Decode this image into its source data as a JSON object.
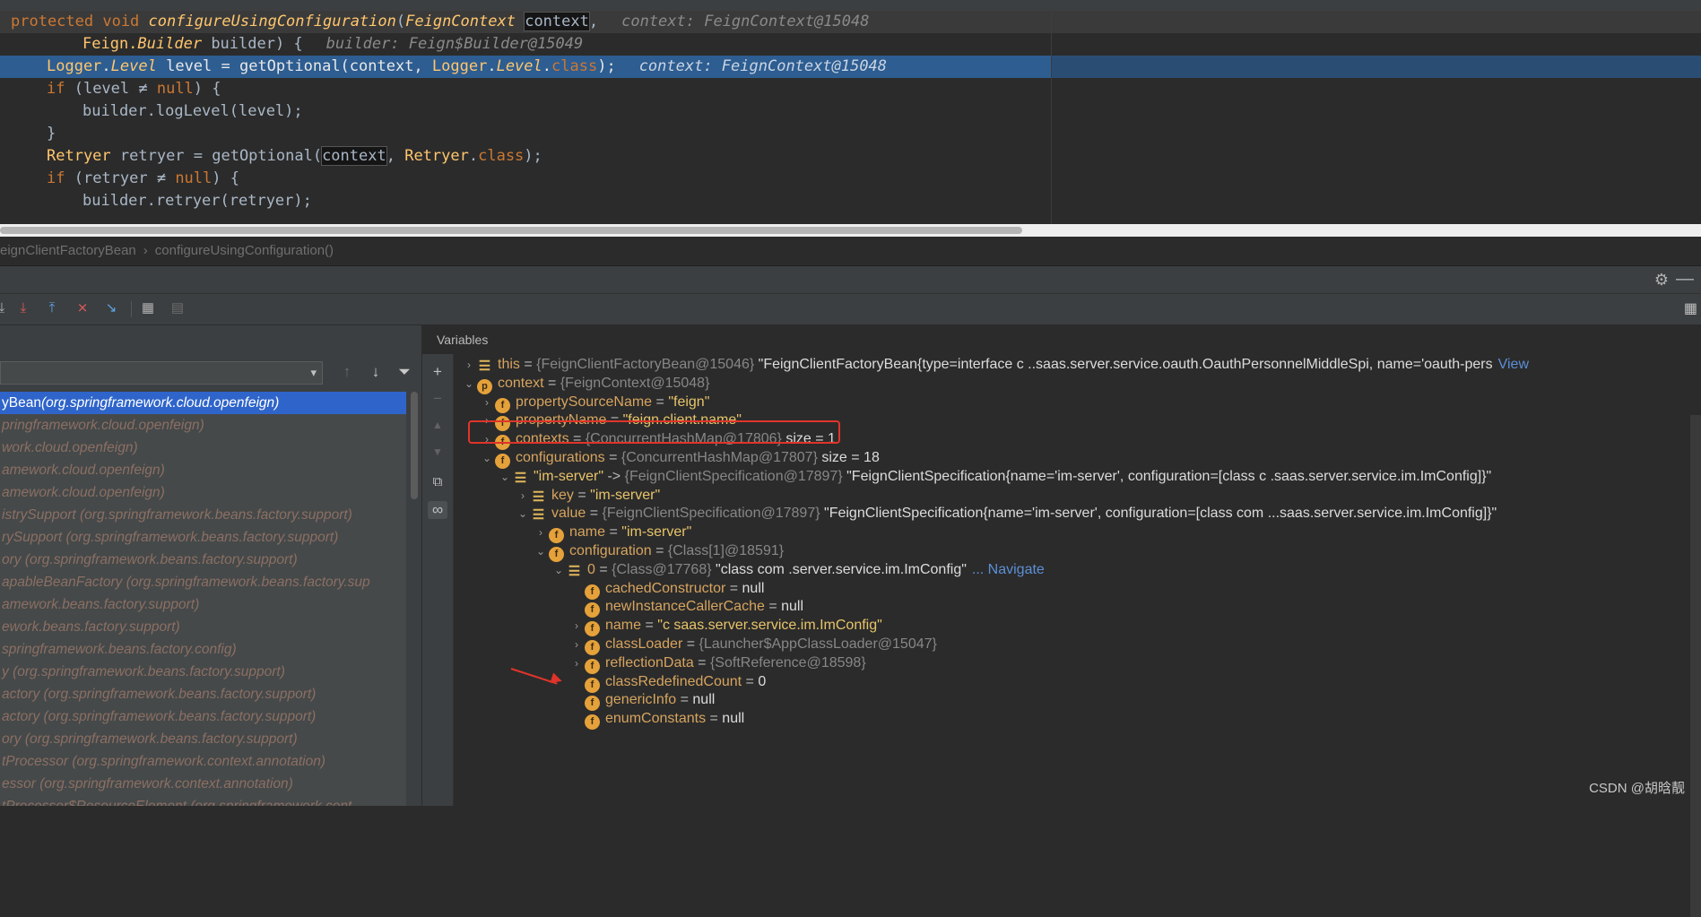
{
  "editor": {
    "lines": [
      {
        "html_parts": [
          "protected void ",
          "configureUsingConfiguration",
          "(",
          "FeignContext",
          " ",
          "context",
          ",",
          "context: FeignContext@15048"
        ]
      },
      {
        "plain": "Feign.Builder builder) {",
        "hint": "builder: Feign$Builder@15049"
      },
      {
        "plain": "Logger.Level level = getOptional(context, Logger.Level.class);",
        "hint": "context: FeignContext@15048"
      },
      {
        "plain": "if (level ≠ null) {"
      },
      {
        "plain": "builder.logLevel(level);"
      },
      {
        "plain": "}"
      },
      {
        "plain": "Retryer retryer = getOptional(context, Retryer.class);"
      },
      {
        "plain": "if (retryer ≠ null) {"
      },
      {
        "plain": "builder.retryer(retryer);"
      }
    ],
    "l1": {
      "kw": "protected void ",
      "method": "configureUsingConfiguration",
      "paren": "(",
      "type": "FeignContext",
      "param": "context",
      "comma": ",",
      "hint": "context: FeignContext@15048"
    },
    "l2": {
      "type": "Feign.",
      "type2": "Builder",
      "rest": " builder) {",
      "hint": "builder: Feign$Builder@15049"
    },
    "l3": {
      "t1": "Logger",
      "d1": ".",
      "t2": "Level",
      "mid": " level = getOptional(context, ",
      "t3": "Logger",
      "d2": ".",
      "t4": "Level",
      "d3": ".",
      "kw": "class",
      "end": ");",
      "hint": "context: FeignContext@15048"
    },
    "l4": {
      "kw": "if",
      "rest": " (level ≠ ",
      "kw2": "null",
      "end": ") {"
    },
    "l5": {
      "text": "builder.logLevel(level);"
    },
    "l6": {
      "text": "}"
    },
    "l7": {
      "t1": "Retryer",
      "mid": " retryer = getOptional(",
      "param": "context",
      "mid2": ", ",
      "t2": "Retryer",
      "d": ".",
      "kw": "class",
      "end": ");"
    },
    "l8": {
      "kw": "if",
      "rest": " (retryer ≠ ",
      "kw2": "null",
      "end": ") {"
    },
    "l9": {
      "text": "builder.retryer(retryer);"
    }
  },
  "breadcrumb": {
    "items": [
      "eignClientFactoryBean",
      "configureUsingConfiguration()"
    ],
    "separator": "›"
  },
  "header": {
    "settings_icon": "gear-icon",
    "minimize_icon": "minimize-icon"
  },
  "toolbar": {
    "icons": [
      "step-into-icon",
      "force-step-into-icon",
      "step-out-icon",
      "drop-frame-icon",
      "run-to-cursor-icon",
      "evaluate-icon",
      "trace-icon"
    ],
    "layout_icon": "layout-icon"
  },
  "frames": {
    "items": [
      {
        "name": "yBean",
        "pkg": "(org.springframework.cloud.openfeign)",
        "selected": true
      },
      {
        "name": "pringframework.cloud.openfeign)",
        "pkg": ""
      },
      {
        "name": "work.cloud.openfeign)",
        "pkg": ""
      },
      {
        "name": "amework.cloud.openfeign)",
        "pkg": ""
      },
      {
        "name": "amework.cloud.openfeign)",
        "pkg": ""
      },
      {
        "name": "istrySupport ",
        "pkg": "(org.springframework.beans.factory.support)"
      },
      {
        "name": "rySupport ",
        "pkg": "(org.springframework.beans.factory.support)"
      },
      {
        "name": "ory ",
        "pkg": "(org.springframework.beans.factory.support)"
      },
      {
        "name": "apableBeanFactory ",
        "pkg": "(org.springframework.beans.factory.sup"
      },
      {
        "name": "amework.beans.factory.support)",
        "pkg": ""
      },
      {
        "name": "ework.beans.factory.support)",
        "pkg": ""
      },
      {
        "name": "springframework.beans.factory.config)",
        "pkg": ""
      },
      {
        "name": "y ",
        "pkg": "(org.springframework.beans.factory.support)"
      },
      {
        "name": "actory ",
        "pkg": "(org.springframework.beans.factory.support)"
      },
      {
        "name": "actory ",
        "pkg": "(org.springframework.beans.factory.support)"
      },
      {
        "name": "ory ",
        "pkg": "(org.springframework.beans.factory.support)"
      },
      {
        "name": "tProcessor ",
        "pkg": "(org.springframework.context.annotation)"
      },
      {
        "name": "essor ",
        "pkg": "(org.springframework.context.annotation)"
      },
      {
        "name": "tProcessor$ResourceElement ",
        "pkg": "(org.springframework.cont"
      }
    ]
  },
  "variables": {
    "title": "Variables",
    "rows": [
      {
        "indent": 0,
        "tri": "›",
        "icon": "eq",
        "name": "this",
        "op": " = ",
        "ref": "{FeignClientFactoryBean@15046}",
        "val": " \"FeignClientFactoryBean{type=interface c        ..saas.server.service.oauth.OauthPersonnelMiddleSpi, name='oauth-pers",
        "link": "View"
      },
      {
        "indent": 0,
        "tri": "⌄",
        "icon": "p",
        "name": "context",
        "op": " = ",
        "ref": "{FeignContext@15048}",
        "val": ""
      },
      {
        "indent": 1,
        "tri": "›",
        "icon": "f",
        "name": "propertySourceName",
        "op": " = ",
        "ref": "",
        "val": "\"feign\"",
        "str": true
      },
      {
        "indent": 1,
        "tri": "›",
        "icon": "f",
        "name": "propertyName",
        "op": " = ",
        "ref": "",
        "val": "\"feign.client.name\"",
        "str": true
      },
      {
        "indent": 1,
        "tri": "›",
        "icon": "f",
        "name": "contexts",
        "op": " = ",
        "ref": "{ConcurrentHashMap@17806}",
        "val": "  size = 1"
      },
      {
        "indent": 1,
        "tri": "⌄",
        "icon": "f",
        "name": "configurations",
        "op": " = ",
        "ref": "{ConcurrentHashMap@17807}",
        "val": "  size = 18"
      },
      {
        "indent": 2,
        "tri": "⌄",
        "icon": "eq",
        "name": "\"im-server\"",
        "op": " -> ",
        "ref": "{FeignClientSpecification@17897}",
        "val": " \"FeignClientSpecification{name='im-server', configuration=[class c           .saas.server.service.im.ImConfig]}\"",
        "namestr": true
      },
      {
        "indent": 3,
        "tri": "›",
        "icon": "eq",
        "name": "key",
        "op": " = ",
        "ref": "",
        "val": "\"im-server\"",
        "str": true
      },
      {
        "indent": 3,
        "tri": "⌄",
        "icon": "eq",
        "name": "value",
        "op": " = ",
        "ref": "{FeignClientSpecification@17897}",
        "val": " \"FeignClientSpecification{name='im-server', configuration=[class com           ...saas.server.service.im.ImConfig]}\""
      },
      {
        "indent": 4,
        "tri": "›",
        "icon": "f",
        "name": "name",
        "op": " = ",
        "ref": "",
        "val": "\"im-server\"",
        "str": true
      },
      {
        "indent": 4,
        "tri": "⌄",
        "icon": "f",
        "name": "configuration",
        "op": " = ",
        "ref": "{Class[1]@18591}",
        "val": ""
      },
      {
        "indent": 5,
        "tri": "⌄",
        "icon": "eq",
        "name": "0",
        "op": " = ",
        "ref": "{Class@17768}",
        "val": " \"class com          .server.service.im.ImConfig\"",
        "link": "... Navigate"
      },
      {
        "indent": 6,
        "tri": "",
        "icon": "f",
        "name": "cachedConstructor",
        "op": " = ",
        "ref": "",
        "val": "null"
      },
      {
        "indent": 6,
        "tri": "",
        "icon": "f",
        "name": "newInstanceCallerCache",
        "op": " = ",
        "ref": "",
        "val": "null"
      },
      {
        "indent": 6,
        "tri": "›",
        "icon": "f",
        "name": "name",
        "op": " = ",
        "ref": "",
        "val": "\"c          saas.server.service.im.ImConfig\"",
        "str": true
      },
      {
        "indent": 6,
        "tri": "›",
        "icon": "f",
        "name": "classLoader",
        "op": " = ",
        "ref": "{Launcher$AppClassLoader@15047}",
        "val": ""
      },
      {
        "indent": 6,
        "tri": "›",
        "icon": "f",
        "name": "reflectionData",
        "op": " = ",
        "ref": "{SoftReference@18598}",
        "val": ""
      },
      {
        "indent": 6,
        "tri": "",
        "icon": "f",
        "name": "classRedefinedCount",
        "op": " = ",
        "ref": "",
        "val": "0"
      },
      {
        "indent": 6,
        "tri": "",
        "icon": "f",
        "name": "genericInfo",
        "op": " = ",
        "ref": "",
        "val": "null"
      },
      {
        "indent": 6,
        "tri": "",
        "icon": "f",
        "name": "enumConstants",
        "op": " = ",
        "ref": "",
        "val": "null"
      }
    ]
  },
  "watermark": "CSDN @胡晗靓",
  "colors": {
    "selection": "#2d5d91",
    "frame_selected": "#2f65ca",
    "annotation": "#e0342a",
    "field_icon": "#e5a13a"
  }
}
